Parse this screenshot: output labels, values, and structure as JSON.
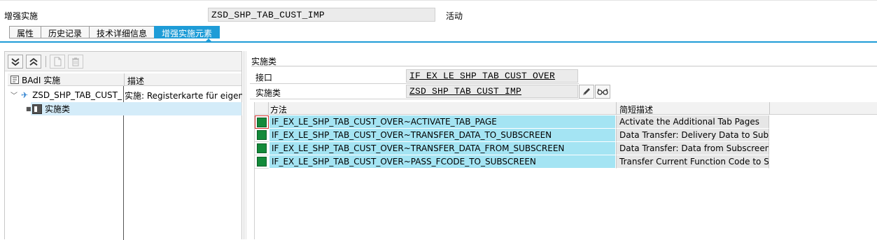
{
  "header": {
    "label": "增强实施",
    "implementation_name": "ZSD_SHP_TAB_CUST_IMP",
    "status": "活动"
  },
  "tabs": [
    {
      "label": "属性",
      "active": false
    },
    {
      "label": "历史记录",
      "active": false
    },
    {
      "label": "技术详细信息",
      "active": false
    },
    {
      "label": "增强实施元素",
      "active": true
    }
  ],
  "left_toolbar": {
    "buttons": [
      {
        "name": "expand-all-icon",
        "enabled": true
      },
      {
        "name": "collapse-all-icon",
        "enabled": true
      },
      {
        "name": "create-document-icon",
        "enabled": false
      },
      {
        "name": "delete-trash-icon",
        "enabled": false
      }
    ]
  },
  "tree": {
    "columns": [
      "BAdI 实施",
      "描述"
    ],
    "rows": [
      {
        "name": "ZSD_SHP_TAB_CUST_",
        "description": "实施: Registerkarte für eigene",
        "icon": "badi-impl-icon"
      },
      {
        "name": "实施类",
        "icon": "implementation-class-icon"
      }
    ]
  },
  "right_panel": {
    "title": "实施类",
    "interface_label": "接口",
    "interface_value": "IF_EX_LE_SHP_TAB_CUST_OVER",
    "class_label": "实施类",
    "class_value": "ZSD_SHP_TAB_CUST_IMP",
    "icons": [
      "edit-pencil-icon",
      "display-glasses-icon"
    ]
  },
  "methods": {
    "columns": [
      "方法",
      "简短描述"
    ],
    "rows": [
      {
        "method": "IF_EX_LE_SHP_TAB_CUST_OVER~ACTIVATE_TAB_PAGE",
        "description": "Activate the Additional Tab Pages"
      },
      {
        "method": "IF_EX_LE_SHP_TAB_CUST_OVER~TRANSFER_DATA_TO_SUBSCREEN",
        "description": "Data Transfer: Delivery Data to Subsc"
      },
      {
        "method": "IF_EX_LE_SHP_TAB_CUST_OVER~TRANSFER_DATA_FROM_SUBSCREEN",
        "description": "Data Transfer: Data from Subscreen"
      },
      {
        "method": "IF_EX_LE_SHP_TAB_CUST_OVER~PASS_FCODE_TO_SUBSCREEN",
        "description": "Transfer Current Function Code to S"
      }
    ]
  },
  "colors": {
    "accent": "#1e9cd7",
    "row_highlight": "#a4e4f3",
    "status_green": "#138a3a",
    "tree_selection": "#d4ecf9"
  }
}
